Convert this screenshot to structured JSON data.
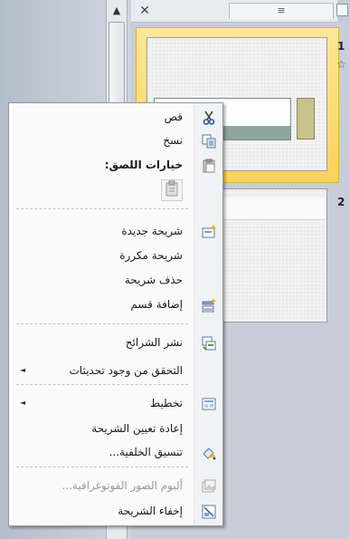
{
  "pane": {
    "close_tab_symbol": "✕",
    "outline_tab_symbol": "≡",
    "scroll_up_symbol": "▲"
  },
  "slides": [
    {
      "number": "1",
      "selected": true,
      "star": "☆"
    },
    {
      "number": "2",
      "selected": false
    }
  ],
  "menu": {
    "items": [
      {
        "label": "قص",
        "icon": "scissors-icon"
      },
      {
        "label": "نسخ",
        "icon": "copy-icon"
      },
      {
        "label": "خيارات اللصق:",
        "icon": "clipboard-icon"
      },
      {
        "label": "شريحة جديدة",
        "icon": "new-slide-icon"
      },
      {
        "label": "شريحة مكررة"
      },
      {
        "label": "حذف شريحة"
      },
      {
        "label": "إضافة قسم",
        "icon": "add-section-icon"
      },
      {
        "label": "نشر الشرائح",
        "icon": "publish-slides-icon"
      },
      {
        "label": "التحقق من وجود تحديثات",
        "submenu": true
      },
      {
        "label": "تخطيط",
        "icon": "layout-icon",
        "submenu": true
      },
      {
        "label": "إعادة تعيين الشريحة"
      },
      {
        "label": "تنسيق الخلفية...",
        "icon": "format-background-icon"
      },
      {
        "label": "ألبوم الصور الفوتوغرافية...",
        "icon": "photo-album-icon",
        "disabled": true
      },
      {
        "label": "إخفاء الشريحة",
        "icon": "hide-slide-icon"
      }
    ],
    "submenu_arrow": "◄"
  }
}
